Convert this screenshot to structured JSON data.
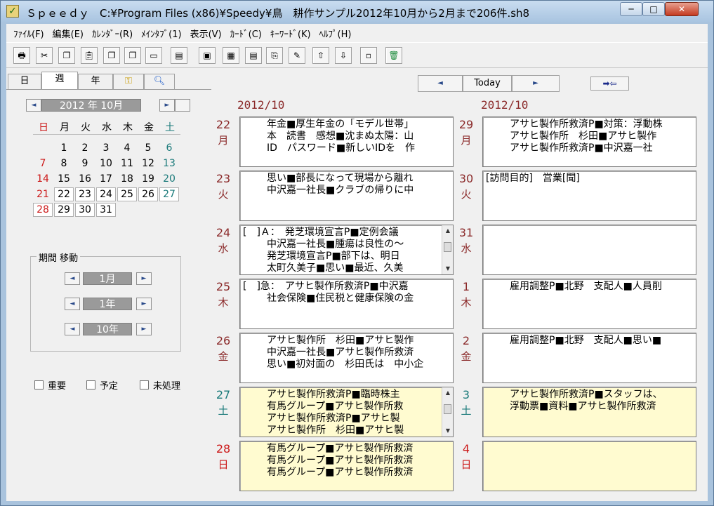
{
  "window": {
    "title": "Ｓｐｅｅｄｙ　C:¥Program Files (x86)¥Speedy¥鳥　耕作サンプル2012年10月から2月まで206件.sh8",
    "minimize": "─",
    "maximize": "□",
    "close": "✕"
  },
  "menu": [
    "ﾌｧｲﾙ(F)",
    "編集(E)",
    "ｶﾚﾝﾀﾞｰ(R)",
    "ﾒｲﾝﾀﾌﾞ(1)",
    "表示(V)",
    "ｶｰﾄﾞ(C)",
    "ｷｰﾜｰﾄﾞ(K)",
    "ﾍﾙﾌﾟ(H)"
  ],
  "toolbar_icons": [
    "print-icon",
    "cut-icon",
    "copy-icon",
    "paste-icon",
    "copy-card-icon",
    "paste-card-icon",
    "card-view-icon",
    "note-icon",
    "window-icon",
    "list-icon",
    "panel-icon",
    "export-icon",
    "tool-icon",
    "upload-icon",
    "download-icon",
    "blank-icon",
    "trash-icon"
  ],
  "tabs": {
    "day": "日",
    "week": "週",
    "year": "年"
  },
  "calendar": {
    "title": "2012 年 10月",
    "weekdays": [
      "日",
      "月",
      "火",
      "水",
      "木",
      "金",
      "土"
    ],
    "rows": [
      [
        "",
        "1",
        "2",
        "3",
        "4",
        "5",
        "6"
      ],
      [
        "7",
        "8",
        "9",
        "10",
        "11",
        "12",
        "13"
      ],
      [
        "14",
        "15",
        "16",
        "17",
        "18",
        "19",
        "20"
      ],
      [
        "21",
        "22",
        "23",
        "24",
        "25",
        "26",
        "27"
      ],
      [
        "28",
        "29",
        "30",
        "31",
        "",
        "",
        ""
      ]
    ]
  },
  "period": {
    "label": "期間 移動",
    "month": "1月",
    "year": "1年",
    "decade": "10年"
  },
  "filters": {
    "important": "重要",
    "scheduled": "予定",
    "unprocessed": "未処理"
  },
  "nav": {
    "today": "Today"
  },
  "week": {
    "left_month": "2012/10",
    "right_month": "2012/10",
    "left_days": [
      {
        "num": "22",
        "wd": "月",
        "entries": [
          "年金■厚生年金の「モデル世帯」",
          "本　読書　感想■沈まぬ太陽：山",
          "ID　パスワード■新しいIDを　作"
        ]
      },
      {
        "num": "23",
        "wd": "火",
        "entries": [
          "思い■部長になって現場から離れ",
          "中沢嘉一社長■クラブの帰りに中"
        ]
      },
      {
        "num": "24",
        "wd": "水",
        "entries": [
          "[　]Ａ：　発芝環境宣言P■定例会議",
          "中沢嘉一社長■腫瘍は良性の～",
          "発芝環境宣言P■部下は、明日",
          "太町久美子■思い■最近、久美"
        ]
      },
      {
        "num": "25",
        "wd": "木",
        "entries": [
          "[　]急：　アサヒ製作所救済P■中沢嘉",
          "社会保険■住民税と健康保険の金"
        ]
      },
      {
        "num": "26",
        "wd": "金",
        "entries": [
          "アサヒ製作所　杉田■アサヒ製作",
          "中沢嘉一社長■アサヒ製作所救済",
          "思い■初対面の　杉田氏は　中小企"
        ]
      },
      {
        "num": "27",
        "wd": "土",
        "entries": [
          "アサヒ製作所救済P■臨時株主",
          "有馬グループ■アサヒ製作所救",
          "アサヒ製作所救済P■アサヒ製",
          "アサヒ製作所　杉田■アサヒ製"
        ]
      },
      {
        "num": "28",
        "wd": "日",
        "entries": [
          "有馬グループ■アサヒ製作所救済",
          "有馬グループ■アサヒ製作所救済",
          "有馬グループ■アサヒ製作所救済"
        ]
      }
    ],
    "right_days": [
      {
        "num": "29",
        "wd": "月",
        "entries": [
          "アサヒ製作所救済P■対策：浮動株",
          "アサヒ製作所　杉田■アサヒ製作",
          "アサヒ製作所救済P■中沢嘉一社"
        ]
      },
      {
        "num": "30",
        "wd": "火",
        "entries": [
          "[訪問目的]　営業[聞]"
        ]
      },
      {
        "num": "31",
        "wd": "水",
        "entries": []
      },
      {
        "num": "1",
        "wd": "木",
        "entries": [
          "雇用調整P■北野　支配人■人員削"
        ]
      },
      {
        "num": "2",
        "wd": "金",
        "entries": [
          "雇用調整P■北野　支配人■思い■"
        ]
      },
      {
        "num": "3",
        "wd": "土",
        "entries": [
          "アサヒ製作所救済P■スタッフは、",
          "浮動票■資料■アサヒ製作所救済"
        ]
      },
      {
        "num": "4",
        "wd": "日",
        "entries": []
      }
    ]
  }
}
